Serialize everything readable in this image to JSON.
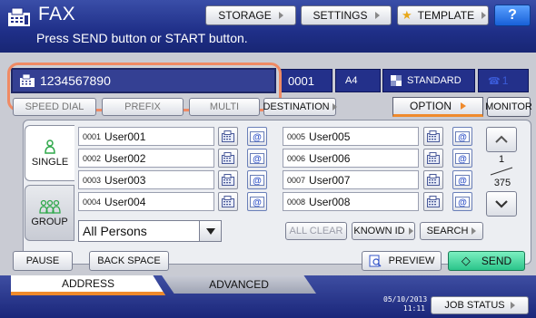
{
  "header": {
    "title": "FAX",
    "instruction": "Press SEND button or START button.",
    "storage_label": "STORAGE",
    "settings_label": "SETTINGS",
    "template_label": "TEMPLATE",
    "help_label": "?"
  },
  "destination": {
    "number": "1234567890",
    "count": "0001",
    "paper_size": "A4",
    "resolution": "STANDARD",
    "line": "1"
  },
  "function_row": {
    "btn1": "SPEED DIAL",
    "btn2": "PREFIX",
    "btn3": "MULTI",
    "destination_label": "DESTINATION",
    "option_label": "OPTION",
    "monitor_label": "MONITOR"
  },
  "side_tabs": {
    "single_label": "SINGLE",
    "group_label": "GROUP"
  },
  "address_book": {
    "entries": [
      {
        "idx": "0001",
        "name": "User001"
      },
      {
        "idx": "0002",
        "name": "User002"
      },
      {
        "idx": "0003",
        "name": "User003"
      },
      {
        "idx": "0004",
        "name": "User004"
      },
      {
        "idx": "0005",
        "name": "User005"
      },
      {
        "idx": "0006",
        "name": "User006"
      },
      {
        "idx": "0007",
        "name": "User007"
      },
      {
        "idx": "0008",
        "name": "User008"
      }
    ],
    "page_current": "1",
    "page_total": "375"
  },
  "filter": {
    "selected": "All Persons"
  },
  "actions": {
    "all_clear": "ALL CLEAR",
    "known_id": "KNOWN ID",
    "search": "SEARCH",
    "pause": "PAUSE",
    "back_space": "BACK SPACE",
    "preview": "PREVIEW",
    "send": "SEND"
  },
  "tabs": {
    "address": "ADDRESS",
    "advanced": "ADVANCED"
  },
  "status": {
    "date": "05/10/2013",
    "time": "11:11",
    "job_status": "JOB STATUS"
  },
  "colors": {
    "title_bar": "#23308a",
    "accent_orange": "#ef8a2c",
    "highlight": "#f08a64",
    "send_green": "#2bc48a"
  }
}
